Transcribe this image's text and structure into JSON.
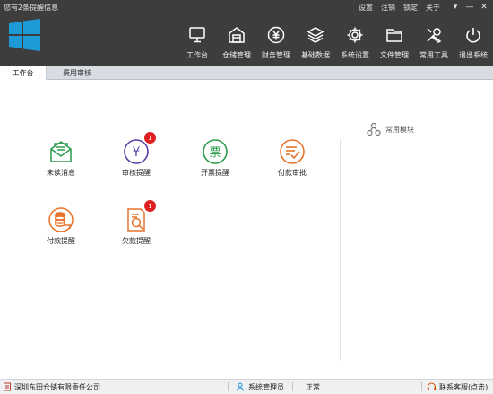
{
  "window": {
    "title": "您有2条提醒信息",
    "links": [
      "设置",
      "注销",
      "锁定",
      "关于"
    ],
    "dropdown": "▾",
    "minimize": "—",
    "close": "✕"
  },
  "nav": [
    {
      "label": "工作台",
      "icon": "monitor-icon"
    },
    {
      "label": "仓储管理",
      "icon": "warehouse-icon"
    },
    {
      "label": "财务管理",
      "icon": "yen-icon"
    },
    {
      "label": "基础数据",
      "icon": "layers-icon"
    },
    {
      "label": "系统设置",
      "icon": "gear-icon"
    },
    {
      "label": "文件管理",
      "icon": "folder-icon"
    },
    {
      "label": "常用工具",
      "icon": "tools-icon"
    },
    {
      "label": "退出系统",
      "icon": "power-icon"
    }
  ],
  "tabs": [
    {
      "label": "工作台",
      "active": true
    },
    {
      "label": "费用审核",
      "active": false
    }
  ],
  "tiles": [
    {
      "label": "未读消息",
      "icon": "mail-icon",
      "color": "#2e9b4e",
      "badge": ""
    },
    {
      "label": "审核提醒",
      "icon": "yen-circle-icon",
      "color": "#5b3fa3",
      "badge": "1",
      "glyph": "¥"
    },
    {
      "label": "开票提醒",
      "icon": "invoice-icon",
      "color": "#2e9b4e",
      "badge": "",
      "glyph": "票"
    },
    {
      "label": "付款审批",
      "icon": "approve-icon",
      "color": "#e8732a",
      "badge": ""
    },
    {
      "label": "付款提醒",
      "icon": "coins-icon",
      "color": "#e8732a",
      "badge": ""
    },
    {
      "label": "欠款提醒",
      "icon": "debt-search-icon",
      "color": "#e8732a",
      "badge": "1"
    }
  ],
  "common_modules": {
    "label": "常用模块",
    "icon": "share-icon"
  },
  "status": {
    "company": "深圳东田仓储有限责任公司",
    "user": "系统管理员",
    "state": "正常",
    "support": "联系客服(点击)"
  },
  "colors": {
    "header": "#3d3d3d",
    "logo": "#1e9ad6",
    "badge": "#e02020"
  }
}
